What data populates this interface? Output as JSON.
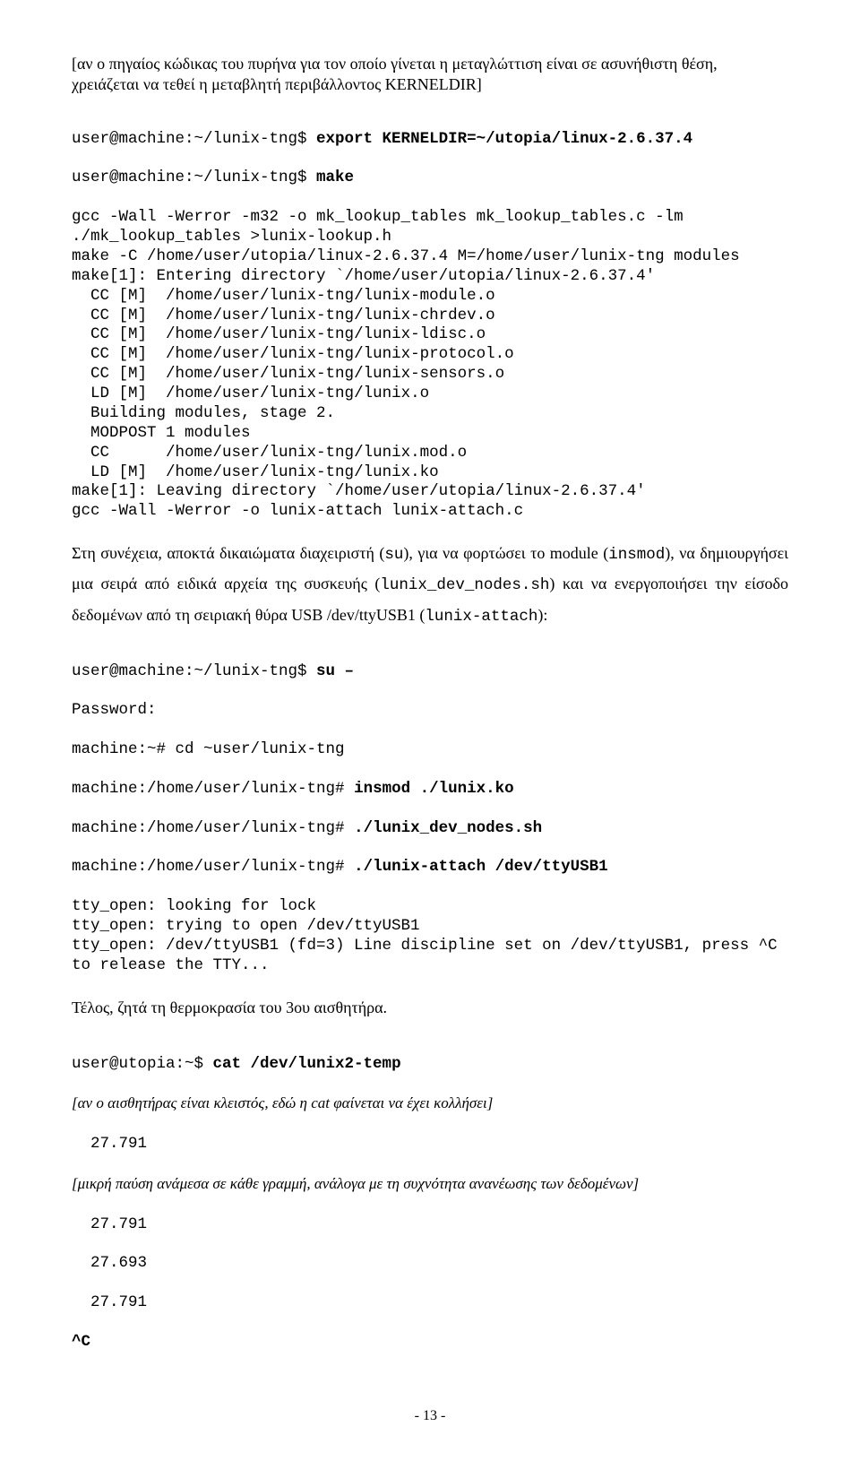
{
  "intro_note": "[αν ο πηγαίος κώδικας του πυρήνα για τον οποίο γίνεται η μεταγλώττιση είναι σε ασυνήθιστη θέση, χρειάζεται να τεθεί η μεταβλητή περιβάλλοντος KERNELDIR]",
  "block1_prompt1_pre": "user@machine:~/lunix-tng$ ",
  "block1_prompt1_cmd": "export KERNELDIR=~/utopia/linux-2.6.37.4",
  "block1_prompt2_pre": "user@machine:~/lunix-tng$ ",
  "block1_prompt2_cmd": "make",
  "block1_body": "gcc -Wall -Werror -m32 -o mk_lookup_tables mk_lookup_tables.c -lm\n./mk_lookup_tables >lunix-lookup.h\nmake -C /home/user/utopia/linux-2.6.37.4 M=/home/user/lunix-tng modules\nmake[1]: Entering directory `/home/user/utopia/linux-2.6.37.4'\n  CC [M]  /home/user/lunix-tng/lunix-module.o\n  CC [M]  /home/user/lunix-tng/lunix-chrdev.o\n  CC [M]  /home/user/lunix-tng/lunix-ldisc.o\n  CC [M]  /home/user/lunix-tng/lunix-protocol.o\n  CC [M]  /home/user/lunix-tng/lunix-sensors.o\n  LD [M]  /home/user/lunix-tng/lunix.o\n  Building modules, stage 2.\n  MODPOST 1 modules\n  CC      /home/user/lunix-tng/lunix.mod.o\n  LD [M]  /home/user/lunix-tng/lunix.ko\nmake[1]: Leaving directory `/home/user/utopia/linux-2.6.37.4'\ngcc -Wall -Werror -o lunix-attach lunix-attach.c",
  "para1_a": "Στη συνέχεια, αποκτά δικαιώματα διαχειριστή (",
  "para1_b": "su",
  "para1_c": "), για να φορτώσει το module (",
  "para1_d": "insmod",
  "para1_e": "),  να  δημιουργήσει  μια  σειρά  από  ειδικά  αρχεία  της  συσκευής (",
  "para1_f": "lunix_dev_nodes.sh",
  "para1_g": ") και να ενεργοποιήσει την είσοδο δεδομένων από τη σειριακή θύρα USB /dev/ttyUSB1 (",
  "para1_h": "lunix-attach",
  "para1_i": "):",
  "block2_l1_pre": "user@machine:~/lunix-tng$ ",
  "block2_l1_cmd": "su –",
  "block2_l2": "Password:",
  "block2_l3": "machine:~# cd ~user/lunix-tng",
  "block2_l4_pre": "machine:/home/user/lunix-tng# ",
  "block2_l4_cmd": "insmod ./lunix.ko",
  "block2_l5_pre": "machine:/home/user/lunix-tng# ",
  "block2_l5_cmd": "./lunix_dev_nodes.sh",
  "block2_l6_pre": "machine:/home/user/lunix-tng# ",
  "block2_l6_cmd": "./lunix-attach /dev/ttyUSB1",
  "block2_rest": "tty_open: looking for lock\ntty_open: trying to open /dev/ttyUSB1\ntty_open: /dev/ttyUSB1 (fd=3) Line discipline set on /dev/ttyUSB1, press ^C to release the TTY...",
  "para2": "Τέλος, ζητά τη θερμοκρασία του 3ου αισθητήρα.",
  "block3_l1_pre": "user@utopia:~$ ",
  "block3_l1_cmd": "cat /dev/lunix2-temp",
  "block3_note1": "[αν ο αισθητήρας είναι κλειστός, εδώ η cat φαίνεται να έχει κολλήσει]",
  "block3_v1": "  27.791",
  "block3_note2": "[μικρή παύση ανάμεσα σε κάθε γραμμή, ανάλογα με τη συχνότητα ανανέωσης των δεδομένων]",
  "block3_v2": "  27.791",
  "block3_v3": "  27.693",
  "block3_v4": "  27.791",
  "block3_v5": "^C",
  "pagenum": "- 13 -"
}
